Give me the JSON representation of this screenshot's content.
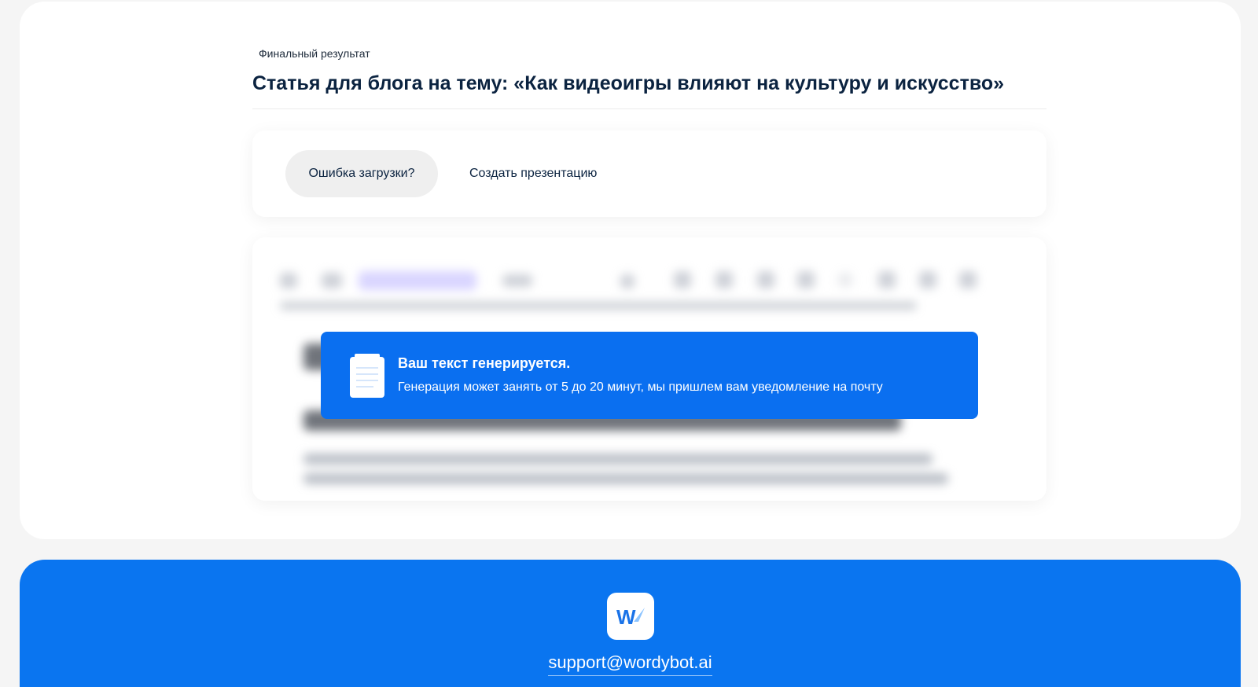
{
  "header": {
    "eyebrow": "Финальный результат",
    "title": "Статья для блога на тему: «Как видеоигры влияют на культуру и искусство»"
  },
  "actions": {
    "error_label": "Ошибка загрузки?",
    "presentation_label": "Создать презентацию"
  },
  "notice": {
    "icon": "clipboard-icon",
    "title": "Ваш текст генерируется.",
    "subtitle": "Генерация может занять от 5 до 20 минут, мы пришлем вам уведомление на почту"
  },
  "footer": {
    "logo_letter": "W",
    "email": "support@wordybot.ai"
  },
  "colors": {
    "accent": "#0a6ff0",
    "footer_bg": "#0a75f0",
    "title": "#0b2340"
  }
}
